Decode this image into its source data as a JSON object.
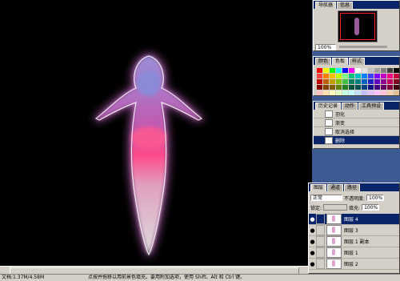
{
  "navigator": {
    "tabs": [
      "导航器",
      "信息"
    ],
    "zoom": "100%"
  },
  "color_palette": {
    "tabs": [
      "颜色",
      "色板",
      "样式"
    ]
  },
  "swatch_colors": [
    "#ff0000",
    "#ffff00",
    "#00ff00",
    "#00ffff",
    "#0000ff",
    "#ff00ff",
    "#ffffff",
    "#e0e0e0",
    "#c0c0c0",
    "#a0a0a0",
    "#808080",
    "#404040",
    "#000000",
    "#ff4040",
    "#ff8000",
    "#ffc000",
    "#c0ff00",
    "#80ff80",
    "#00c080",
    "#00c0c0",
    "#0080ff",
    "#4040ff",
    "#8000ff",
    "#c000c0",
    "#ff0080",
    "#c00040",
    "#c00000",
    "#c06000",
    "#c0a000",
    "#80c000",
    "#40c040",
    "#008060",
    "#008080",
    "#0060c0",
    "#2020c0",
    "#6000c0",
    "#900090",
    "#c00060",
    "#800020",
    "#800000",
    "#804000",
    "#806000",
    "#608000",
    "#208020",
    "#005040",
    "#005050",
    "#004080",
    "#101080",
    "#400080",
    "#600060",
    "#800040",
    "#400010",
    "#ffc0c0",
    "#ffe0b0",
    "#ffffc0",
    "#e0ffc0",
    "#c0ffe0",
    "#c0ffff",
    "#c0e0ff",
    "#c0c0ff",
    "#e0c0ff",
    "#ffc0ff",
    "#ffc0e0",
    "#f0d0b0",
    "#e0c090"
  ],
  "history": {
    "tabs": [
      "历史记录",
      "动作",
      "工具预设"
    ],
    "items": [
      "羽化",
      "渐变",
      "取消选择",
      "删除"
    ],
    "selected": 3
  },
  "layers": {
    "tabs": [
      "图层",
      "通道",
      "路径"
    ],
    "blend_mode": "正常",
    "opacity_label": "不透明度:",
    "opacity": "100%",
    "lock_label": "锁定:",
    "fill_label": "填充:",
    "fill": "100%",
    "rows": [
      "图层 4",
      "图层 3",
      "图层 1 副本",
      "图层 1",
      "图层 2"
    ],
    "selected": 0
  },
  "status": {
    "doc": "文档:1.37M/4.58M",
    "hint": "点按并拖移以用前景色填充。要用附加选项，使用 Shift、Alt 和 Ctrl 键。"
  }
}
